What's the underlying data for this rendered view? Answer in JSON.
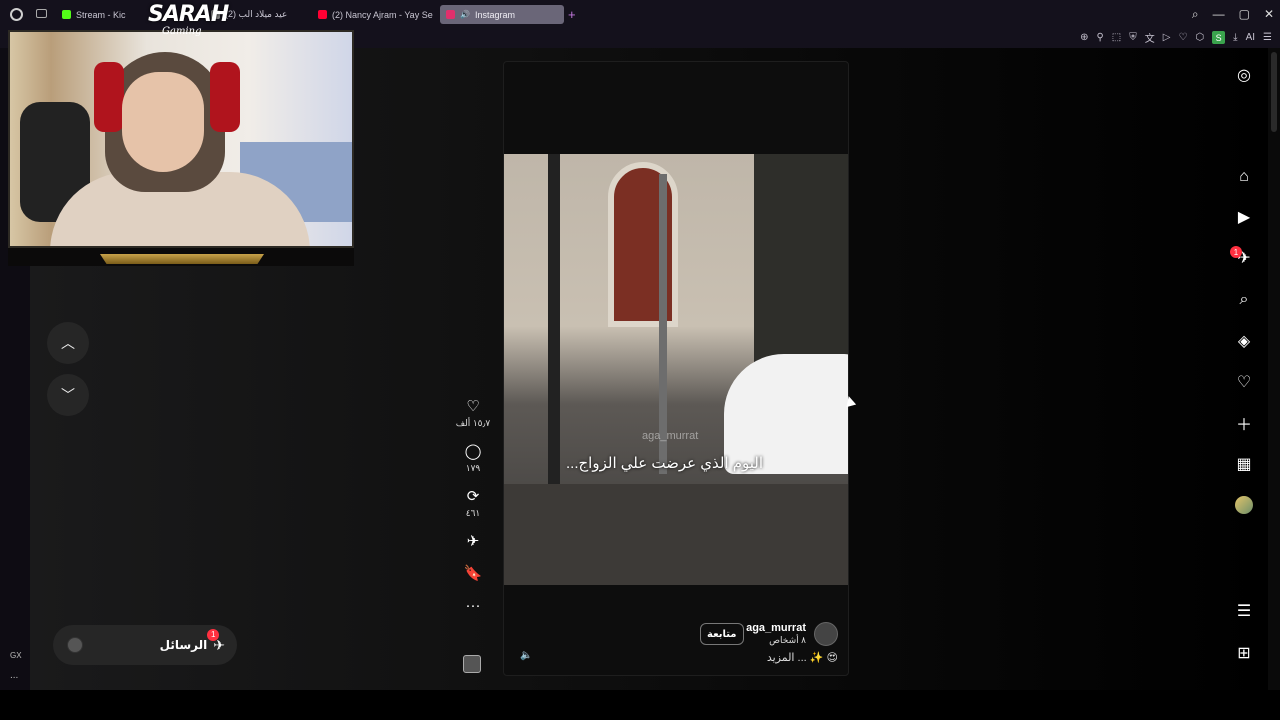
{
  "browser": {
    "tabs": [
      {
        "label": "Stream - Kic",
        "favicon_color": "#53fc18"
      },
      {
        "label": "(2) عيد ميلاد الب",
        "favicon_color": "#888888"
      },
      {
        "label": "(2) Nancy Ajram - Yay Se",
        "favicon_color": "#ff0033"
      },
      {
        "label": "Instagram",
        "favicon_color": "#e1306c",
        "active": true
      }
    ],
    "new_tab": "+",
    "window_controls": [
      "⌕",
      "—",
      "▢",
      "✕"
    ],
    "extension_badge": "S",
    "ai_label": "AI",
    "sidebar_label": "GX",
    "sidebar_more": "..."
  },
  "overlay": {
    "brand": "SARAH",
    "brand_sub": "Gaming"
  },
  "nav": {
    "up_icon": "chevron-up-icon",
    "down_icon": "chevron-down-icon"
  },
  "messages": {
    "label": "الرسائل",
    "badge": "1"
  },
  "reel": {
    "watermark": "aga_murrat",
    "video_caption": "اليوم الذي عرضت علي الزواج...",
    "username": "aga_murrat",
    "people": "٨ أشخاص",
    "follow_label": "متابعة",
    "caption": "المزيد ... ✨ 😍"
  },
  "actions": {
    "likes": "١٥٫٧ ألف",
    "comments": "١٧٩",
    "reposts": "٤٦١"
  },
  "ig_sidebar": {
    "notification_badge": "1",
    "items": [
      "instagram-icon",
      "home-icon",
      "reels-icon",
      "direct-icon",
      "search-icon",
      "explore-icon",
      "notifications-icon",
      "create-icon",
      "dashboard-icon",
      "profile-icon",
      "menu-icon",
      "more-icon"
    ]
  },
  "colors": {
    "accent": "#ff3040",
    "tab_active": "#6a6678",
    "gold": "#c8a24a"
  }
}
